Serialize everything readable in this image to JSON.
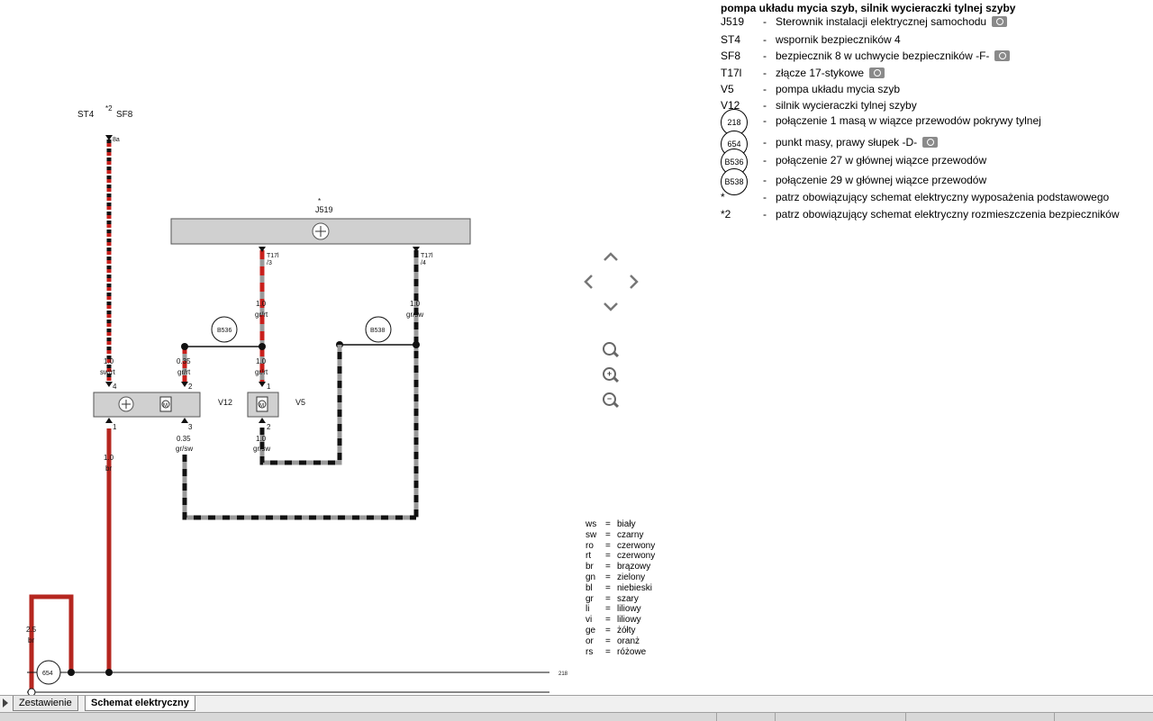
{
  "legend": {
    "title": "pompa układu mycia szyb, silnik wycieraczki tylnej szyby",
    "rows": [
      {
        "code": "J519",
        "desc": "Sterownik instalacji elektrycznej samochodu",
        "camera": true
      },
      {
        "code": "ST4",
        "desc": "wspornik bezpieczników 4",
        "camera": false
      },
      {
        "code": "SF8",
        "desc": "bezpiecznik 8 w uchwycie bezpieczników -F-",
        "camera": true
      },
      {
        "code": "T17l",
        "desc": "złącze 17-stykowe",
        "camera": true
      },
      {
        "code": "V5",
        "desc": "pompa układu mycia szyb",
        "camera": false
      },
      {
        "code": "V12",
        "desc": "silnik wycieraczki tylnej szyby",
        "camera": false
      },
      {
        "circle": "218",
        "desc": "połączenie 1 masą w wiązce przewodów pokrywy tylnej",
        "camera": false
      },
      {
        "circle": "654",
        "desc": "punkt masy, prawy słupek -D-",
        "camera": true
      },
      {
        "circle": "B536",
        "desc": "połączenie 27 w głównej wiązce przewodów",
        "camera": false
      },
      {
        "circle": "B538",
        "desc": "połączenie 29 w głównej wiązce przewodów",
        "camera": false
      },
      {
        "code": "*",
        "desc": "patrz obowiązujący schemat elektryczny wyposażenia podstawowego",
        "camera": false
      },
      {
        "code": "*2",
        "desc": "patrz obowiązujący schemat elektryczny rozmieszczenia bezpieczników",
        "camera": false
      }
    ]
  },
  "colors_legend": [
    {
      "abbr": "ws",
      "name": "biały"
    },
    {
      "abbr": "sw",
      "name": "czarny"
    },
    {
      "abbr": "ro",
      "name": "czerwony"
    },
    {
      "abbr": "rt",
      "name": "czerwony"
    },
    {
      "abbr": "br",
      "name": "brązowy"
    },
    {
      "abbr": "gn",
      "name": "zielony"
    },
    {
      "abbr": "bl",
      "name": "niebieski"
    },
    {
      "abbr": "gr",
      "name": "szary"
    },
    {
      "abbr": "li",
      "name": "liliowy"
    },
    {
      "abbr": "vi",
      "name": "liliowy"
    },
    {
      "abbr": "ge",
      "name": "żółty"
    },
    {
      "abbr": "or",
      "name": "oranż"
    },
    {
      "abbr": "rs",
      "name": "różowe"
    }
  ],
  "diagram": {
    "labels": {
      "st4": "ST4",
      "sf8_star": "*2",
      "sf8": "SF8",
      "sf8_pin": "8a",
      "j519_star": "*",
      "j519": "J519",
      "t17l_a": "T17l",
      "t17l_a_pin": "/3",
      "t17l_b": "T17l",
      "t17l_b_pin": "/4",
      "w1_size": "1.0",
      "w1_col": "gr/rt",
      "w2_size": "1.0",
      "w2_col": "gr/sw",
      "b536": "B536",
      "b538": "B538",
      "w3_size": "1.0",
      "w3_col": "sw/rt",
      "w4_size": "0.35",
      "w4_col": "gr/rt",
      "w5_size": "1.0",
      "w5_col": "gr/rt",
      "v12_pin4": "4",
      "v12_pin2": "2",
      "v12_pin1": "1",
      "v12_pin3": "3",
      "v5_pin1": "1",
      "v5_pin2": "2",
      "v12": "V12",
      "v5": "V5",
      "w6_size": "1.0",
      "w6_col": "br",
      "w7_size": "0.35",
      "w7_col": "gr/sw",
      "w8_size": "1.0",
      "w8_col": "gr/sw",
      "w9_size": "2.5",
      "w9_col": "br",
      "g654": "654",
      "g218": "218",
      "motor_m": "M"
    },
    "wire_colors": {
      "red": "#c8201c",
      "black": "#111111",
      "grey": "#9a9a9a",
      "brown": "#b5261f"
    }
  },
  "nav": {
    "up": "up-arrow",
    "left": "left-arrow",
    "right": "right-arrow",
    "down": "down-arrow"
  },
  "tabs": [
    {
      "label": "Zestawienie",
      "active": false
    },
    {
      "label": "Schemat elektryczny",
      "active": true
    }
  ]
}
